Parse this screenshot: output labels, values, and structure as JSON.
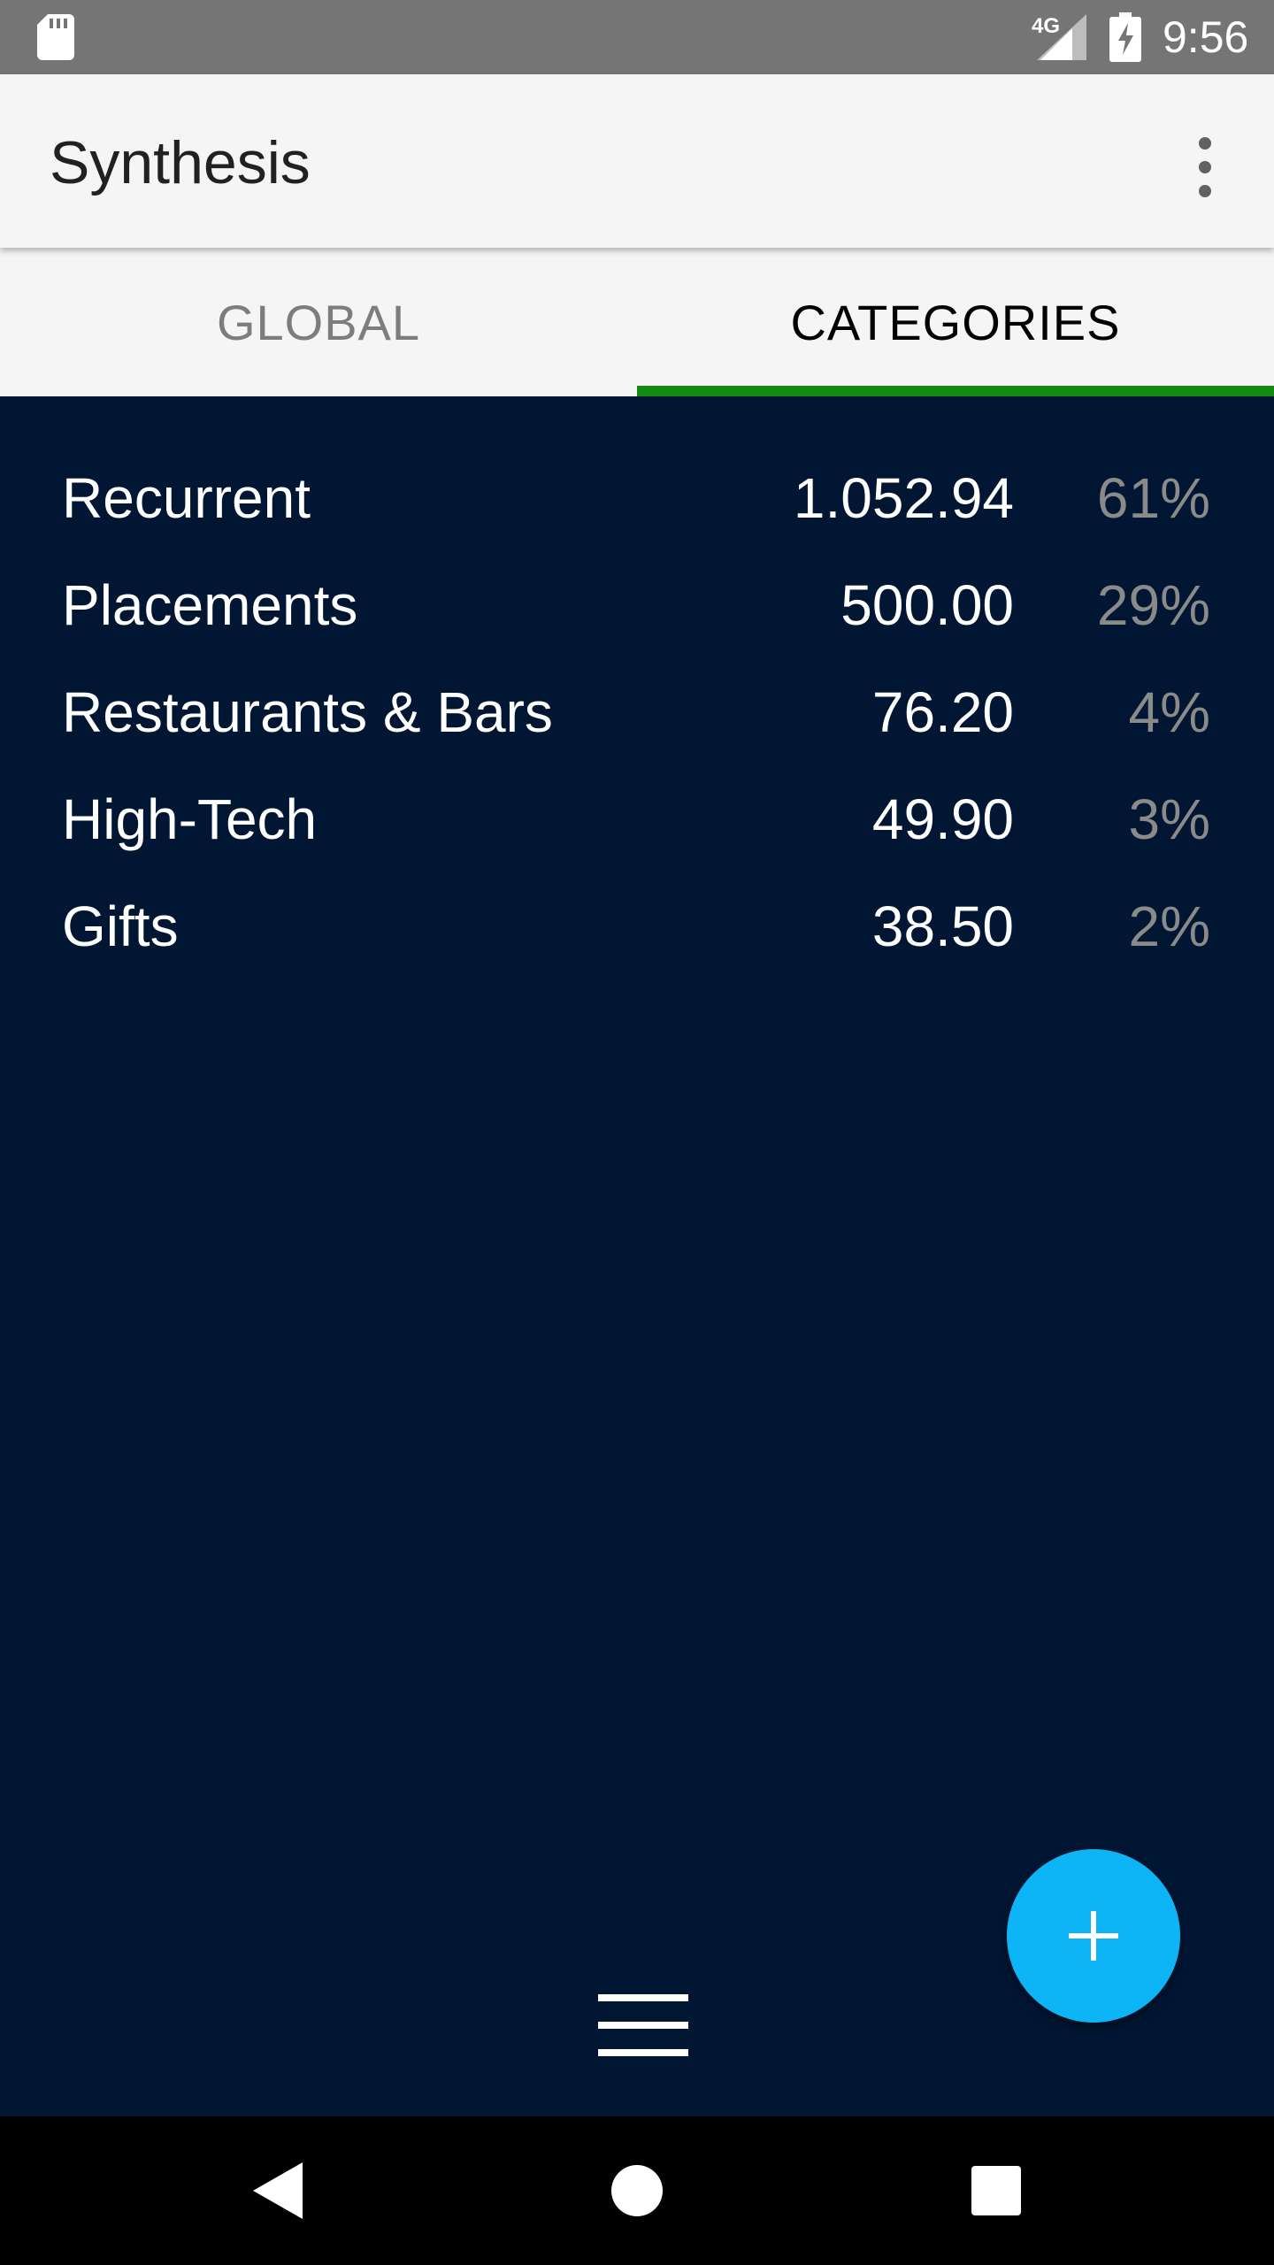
{
  "status_bar": {
    "network": "4G",
    "time": "9:56",
    "icons": [
      "sd-card-icon",
      "signal-icon",
      "battery-charging-icon"
    ]
  },
  "app_bar": {
    "title": "Synthesis",
    "menu_icon": "overflow-menu-icon"
  },
  "tabs": [
    {
      "label": "GLOBAL",
      "selected": false
    },
    {
      "label": "CATEGORIES",
      "selected": true
    }
  ],
  "colors": {
    "background": "#011633",
    "tab_indicator": "#138a13",
    "fab": "#0db4f6",
    "percent_text": "#8a8a8a"
  },
  "categories": [
    {
      "name": "Recurrent",
      "amount": "1.052.94",
      "percent": "61%"
    },
    {
      "name": "Placements",
      "amount": "500.00",
      "percent": "29%"
    },
    {
      "name": "Restaurants & Bars",
      "amount": "76.20",
      "percent": "4%"
    },
    {
      "name": "High-Tech",
      "amount": "49.90",
      "percent": "3%"
    },
    {
      "name": "Gifts",
      "amount": "38.50",
      "percent": "2%"
    }
  ],
  "fab": {
    "icon": "plus-icon"
  },
  "bottom": {
    "icon": "hamburger-menu-icon"
  },
  "nav_bar": {
    "icons": [
      "back-icon",
      "home-icon",
      "recents-icon"
    ]
  }
}
